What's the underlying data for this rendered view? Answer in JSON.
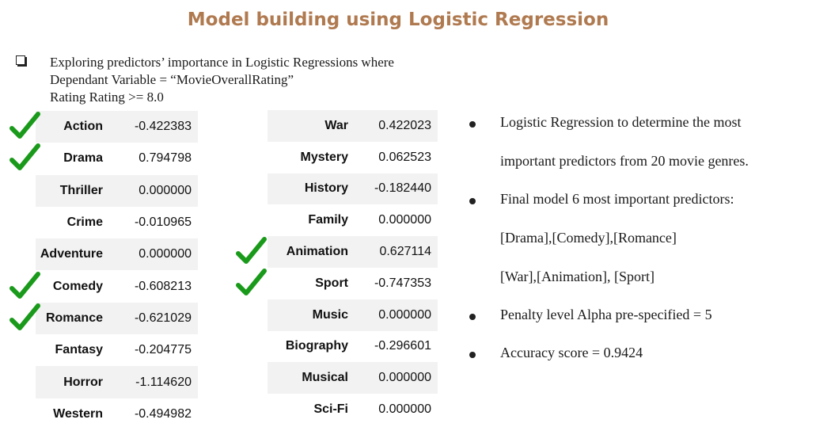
{
  "title": "Model building using Logistic Regression",
  "intro": {
    "line1": "Exploring predictors’ importance in Logistic Regressions  where",
    "line2": "Dependant Variable = “MovieOverallRating”",
    "line3": "Rating Rating >= 8.0"
  },
  "table_left": [
    {
      "name": "Action",
      "value": "-0.422383",
      "checked": true
    },
    {
      "name": "Drama",
      "value": "0.794798",
      "checked": true
    },
    {
      "name": "Thriller",
      "value": "0.000000",
      "checked": false
    },
    {
      "name": "Crime",
      "value": "-0.010965",
      "checked": false
    },
    {
      "name": "Adventure",
      "value": "0.000000",
      "checked": false
    },
    {
      "name": "Comedy",
      "value": "-0.608213",
      "checked": true
    },
    {
      "name": "Romance",
      "value": "-0.621029",
      "checked": true
    },
    {
      "name": "Fantasy",
      "value": "-0.204775",
      "checked": false
    },
    {
      "name": "Horror",
      "value": "-1.114620",
      "checked": false
    },
    {
      "name": "Western",
      "value": "-0.494982",
      "checked": false
    }
  ],
  "table_right": [
    {
      "name": "War",
      "value": "0.422023",
      "checked": false
    },
    {
      "name": "Mystery",
      "value": "0.062523",
      "checked": false
    },
    {
      "name": "History",
      "value": "-0.182440",
      "checked": false
    },
    {
      "name": "Family",
      "value": "0.000000",
      "checked": false
    },
    {
      "name": "Animation",
      "value": "0.627114",
      "checked": true
    },
    {
      "name": "Sport",
      "value": "-0.747353",
      "checked": true
    },
    {
      "name": "Music",
      "value": "0.000000",
      "checked": false
    },
    {
      "name": "Biography",
      "value": "-0.296601",
      "checked": false
    },
    {
      "name": "Musical",
      "value": "0.000000",
      "checked": false
    },
    {
      "name": "Sci-Fi",
      "value": "0.000000",
      "checked": false
    }
  ],
  "check_color": "#1a9a1a",
  "summary": {
    "b1_line1": "Logistic Regression  to determine the most",
    "b1_line2": "important predictors  from 20 movie  genres.",
    "b2_line1": "Final model 6 most important predictors:",
    "b2_line2": "[Drama],[Comedy],[Romance]",
    "b2_line3": "[War],[Animation], [Sport]",
    "b3": "Penalty level Alpha pre-specified = 5",
    "b4": "Accuracy score = 0.9424"
  }
}
